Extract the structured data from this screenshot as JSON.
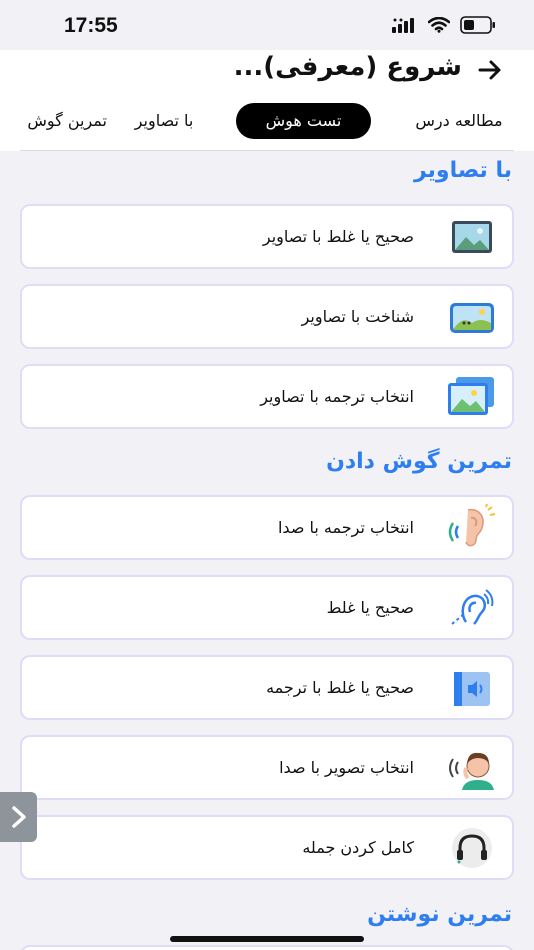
{
  "status_bar": {
    "time": "17:55"
  },
  "header": {
    "back_icon": "arrow-right-icon",
    "title": "شروع (معرفی)..."
  },
  "tabs": [
    {
      "label": "مطالعه درس",
      "active": false
    },
    {
      "label": "تست هوش",
      "active": true
    },
    {
      "label": "با تصاویر",
      "active": false
    },
    {
      "label": "تمرین گوش",
      "active": false
    }
  ],
  "sections": [
    {
      "title": "با تصاویر",
      "items": [
        {
          "label": "صحیح یا غلط با تصاویر",
          "icon": "picture-frame-icon"
        },
        {
          "label": "شناخت با تصاویر",
          "icon": "landscape-photo-icon"
        },
        {
          "label": "انتخاب ترجمه با تصاویر",
          "icon": "gallery-icon"
        }
      ]
    },
    {
      "title": "تمرین گوش دادن",
      "items": [
        {
          "label": "انتخاب ترجمه با صدا",
          "icon": "ear-sound-icon"
        },
        {
          "label": "صحیح یا غلط",
          "icon": "hearing-icon"
        },
        {
          "label": "صحیح یا غلط با ترجمه",
          "icon": "speaker-icon"
        },
        {
          "label": "انتخاب تصویر با صدا",
          "icon": "person-listening-icon"
        },
        {
          "label": "کامل کردن جمله",
          "icon": "headphones-icon"
        }
      ]
    },
    {
      "title": "تمرین نوشتن",
      "items": []
    }
  ],
  "side_handle": {
    "icon": "chevron-right-icon"
  },
  "colors": {
    "accent": "#2f7ef0",
    "card_border": "#dedcf6",
    "background": "#f2f2f6",
    "active_tab": "#000000"
  }
}
